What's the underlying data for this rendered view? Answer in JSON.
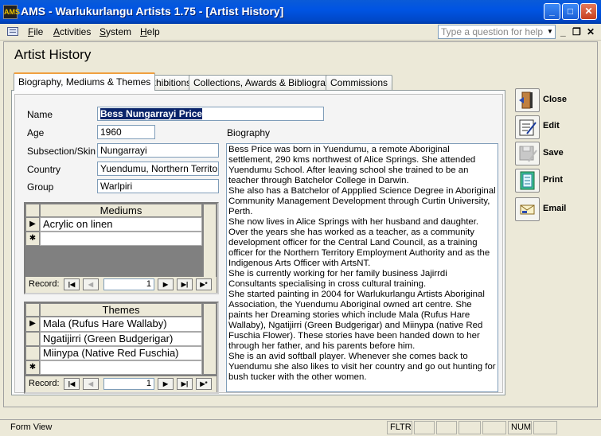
{
  "window": {
    "app_icon": "AMS",
    "title": "AMS - Warlukurlangu Artists 1.75 - [Artist History]",
    "minimize_symbol": "_",
    "maximize_symbol": "□",
    "close_symbol": "✕"
  },
  "menu": {
    "file_first": "F",
    "file_rest": "ile",
    "activities_first": "A",
    "activities_rest": "ctivities",
    "system_first": "S",
    "system_rest": "ystem",
    "help_first": "H",
    "help_rest": "elp",
    "help_placeholder": "Type a question for help",
    "mdi_min": "_",
    "mdi_restore": "❐",
    "mdi_close": "✕"
  },
  "form": {
    "title": "Artist History",
    "tabs": [
      {
        "label": "Biography, Mediums & Themes"
      },
      {
        "label": "Exhibitions"
      },
      {
        "label": "Collections, Awards & Bibliography"
      },
      {
        "label": "Commissions"
      }
    ],
    "fields": {
      "name_label": "Name",
      "name_value": "Bess Nungarrayi Price",
      "age_label": "Age",
      "age_value": "1960",
      "subsection_label": "Subsection/Skin",
      "subsection_value": "Nungarrayi",
      "country_label": "Country",
      "country_value": "Yuendumu, Northern Territory, A",
      "group_label": "Group",
      "group_value": "Warlpiri",
      "biography_label": "Biography"
    },
    "mediums": {
      "header": "Mediums",
      "rows": [
        "Acrylic on linen"
      ],
      "record_label": "Record:",
      "record_value": "1"
    },
    "themes": {
      "header": "Themes",
      "rows": [
        "Mala (Rufus Hare Wallaby)",
        "Ngatijirri (Green Budgerigar)",
        "Miinypa (Native Red Fuschia)"
      ],
      "record_label": "Record:",
      "record_value": "1"
    },
    "nav_symbols": {
      "first": "|◀",
      "prev": "◀",
      "next": "▶",
      "last": "▶|",
      "new": "▶*"
    },
    "row_symbols": {
      "current": "▶",
      "new": "✱"
    },
    "biography": [
      "Bess Price was born in Yuendumu, a remote Aboriginal settlement, 290 kms northwest of Alice Springs. She attended Yuendumu School.  After leaving school she trained to be an teacher through Batchelor College in Darwin.",
      "She also has a Batchelor of Appplied Science Degree in Aboriginal Community Management Development through Curtin University, Perth.",
      "She now lives in Alice Springs with her husband and daughter. Over the years she has worked as a teacher, as a community development officer for the Central Land Council, as a training officer  for the Northern Territory Employment Authority and as the Indigenous Arts Officer with  ArtsNT.",
      "She is currently working for her family business Jajirrdi Consultants specialising in cross cultural training.",
      "She started painting in 2004 for Warlukurlangu Artists Aboriginal Association, the Yuendumu  Aboriginal owned art centre.  She paints her Dreaming stories which include Mala (Rufus Hare Wallaby), Ngatijirri (Green Budgerigar) and Miinypa (native Red Fuschia Flower).  These stories have been handed down to her through her father, and his parents before him.",
      "She is an avid softball player.  Whenever she comes back to Yuendumu she also  likes to visit her country and go out hunting for bush tucker with the other women."
    ]
  },
  "side_buttons": [
    {
      "label": "Close",
      "icon": "door-exit-icon"
    },
    {
      "label": "Edit",
      "icon": "edit-form-icon"
    },
    {
      "label": "Save",
      "icon": "floppy-disk-icon"
    },
    {
      "label": "Print",
      "icon": "notebook-print-icon"
    },
    {
      "label": "Email",
      "icon": "envelope-icon"
    }
  ],
  "status": {
    "view": "Form View",
    "fltr": "FLTR",
    "num": "NUM"
  }
}
